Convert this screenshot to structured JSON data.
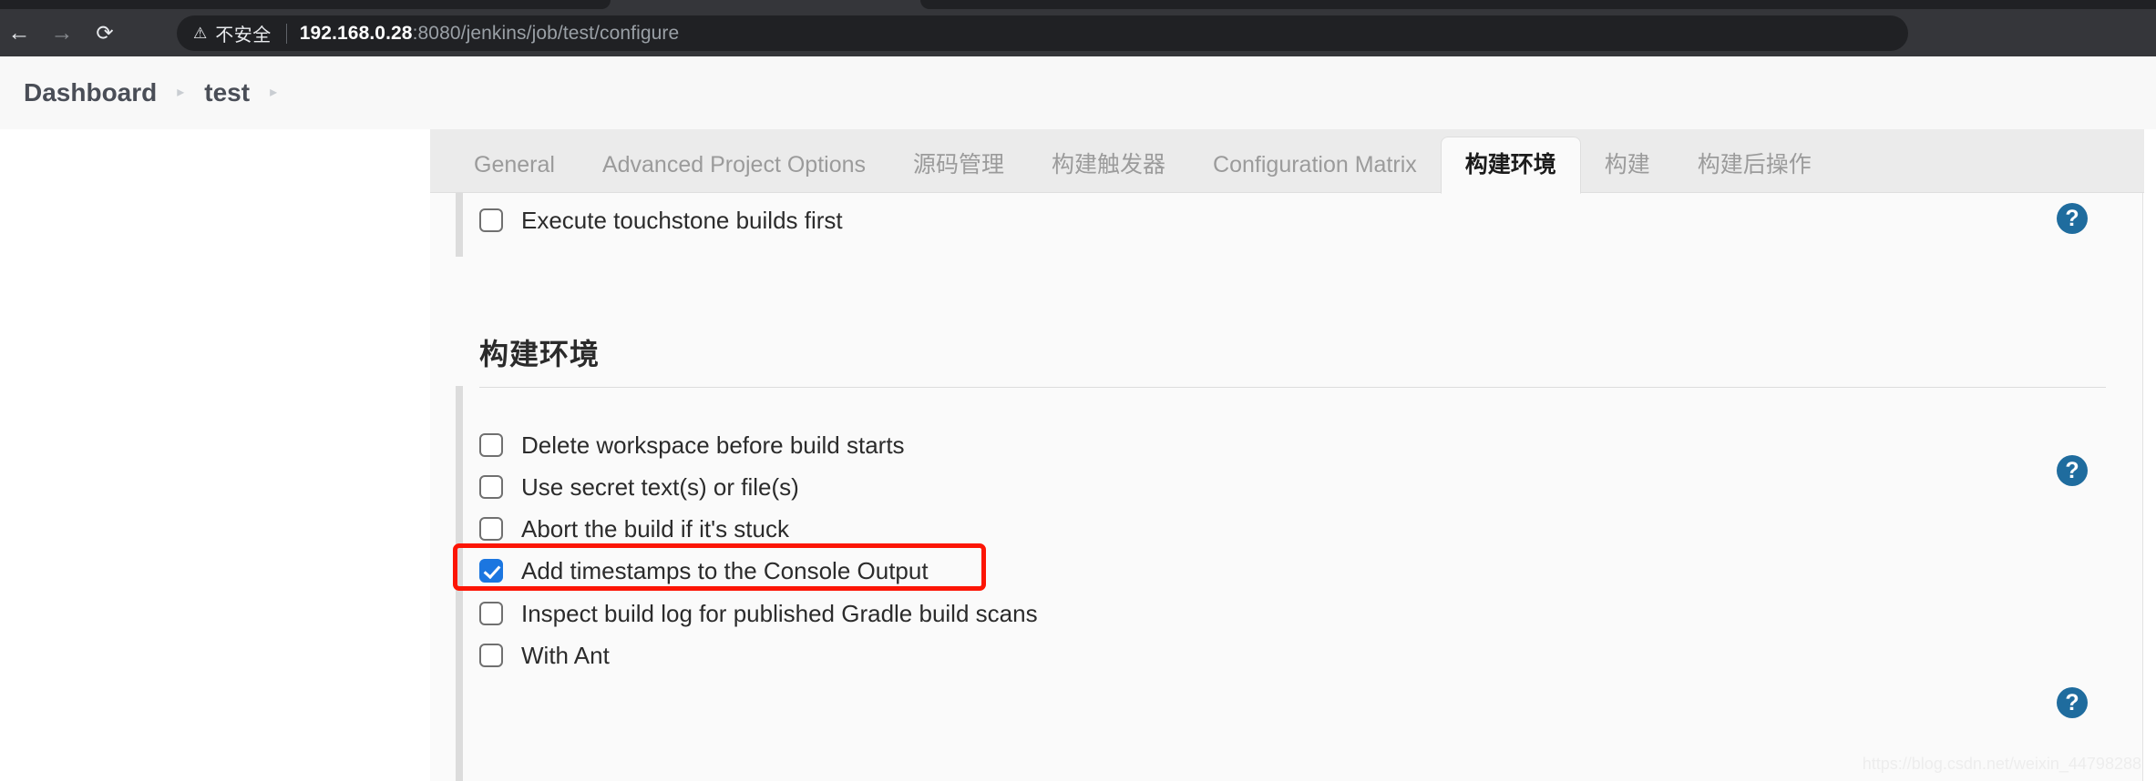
{
  "browser": {
    "back_icon": "arrow-left-icon",
    "forward_icon": "arrow-right-icon",
    "reload_icon": "reload-icon",
    "warning_icon": "warning-triangle-icon",
    "security_label": "不安全",
    "url_host": "192.168.0.28",
    "url_rest": ":8080/jenkins/job/test/configure",
    "url_full": "192.168.0.28:8080/jenkins/job/test/configure"
  },
  "breadcrumb": {
    "items": [
      {
        "label": "Dashboard"
      },
      {
        "label": "test"
      }
    ],
    "separator": "▸"
  },
  "tabs": [
    {
      "label": "General",
      "active": false
    },
    {
      "label": "Advanced Project Options",
      "active": false
    },
    {
      "label": "源码管理",
      "active": false
    },
    {
      "label": "构建触发器",
      "active": false
    },
    {
      "label": "Configuration Matrix",
      "active": false
    },
    {
      "label": "构建环境",
      "active": true
    },
    {
      "label": "构建",
      "active": false
    },
    {
      "label": "构建后操作",
      "active": false
    }
  ],
  "form": {
    "top_option": {
      "label": "Execute touchstone builds first",
      "checked": false
    },
    "section_title": "构建环境",
    "options": [
      {
        "label": "Delete workspace before build starts",
        "checked": false
      },
      {
        "label": "Use secret text(s) or file(s)",
        "checked": false
      },
      {
        "label": "Abort the build if it's stuck",
        "checked": false
      },
      {
        "label": "Add timestamps to the Console Output",
        "checked": true
      },
      {
        "label": "Inspect build log for published Gradle build scans",
        "checked": false
      },
      {
        "label": "With Ant",
        "checked": false
      }
    ],
    "help_label": "?",
    "help_count": 3
  },
  "watermark": "https://blog.csdn.net/weixin_44798288",
  "colors": {
    "accent_blue": "#1b76e0",
    "help_blue": "#1f6c9e",
    "highlight_red": "#fc1505",
    "panel_bg": "#fafafa",
    "tabbar_bg": "#ebebeb"
  }
}
